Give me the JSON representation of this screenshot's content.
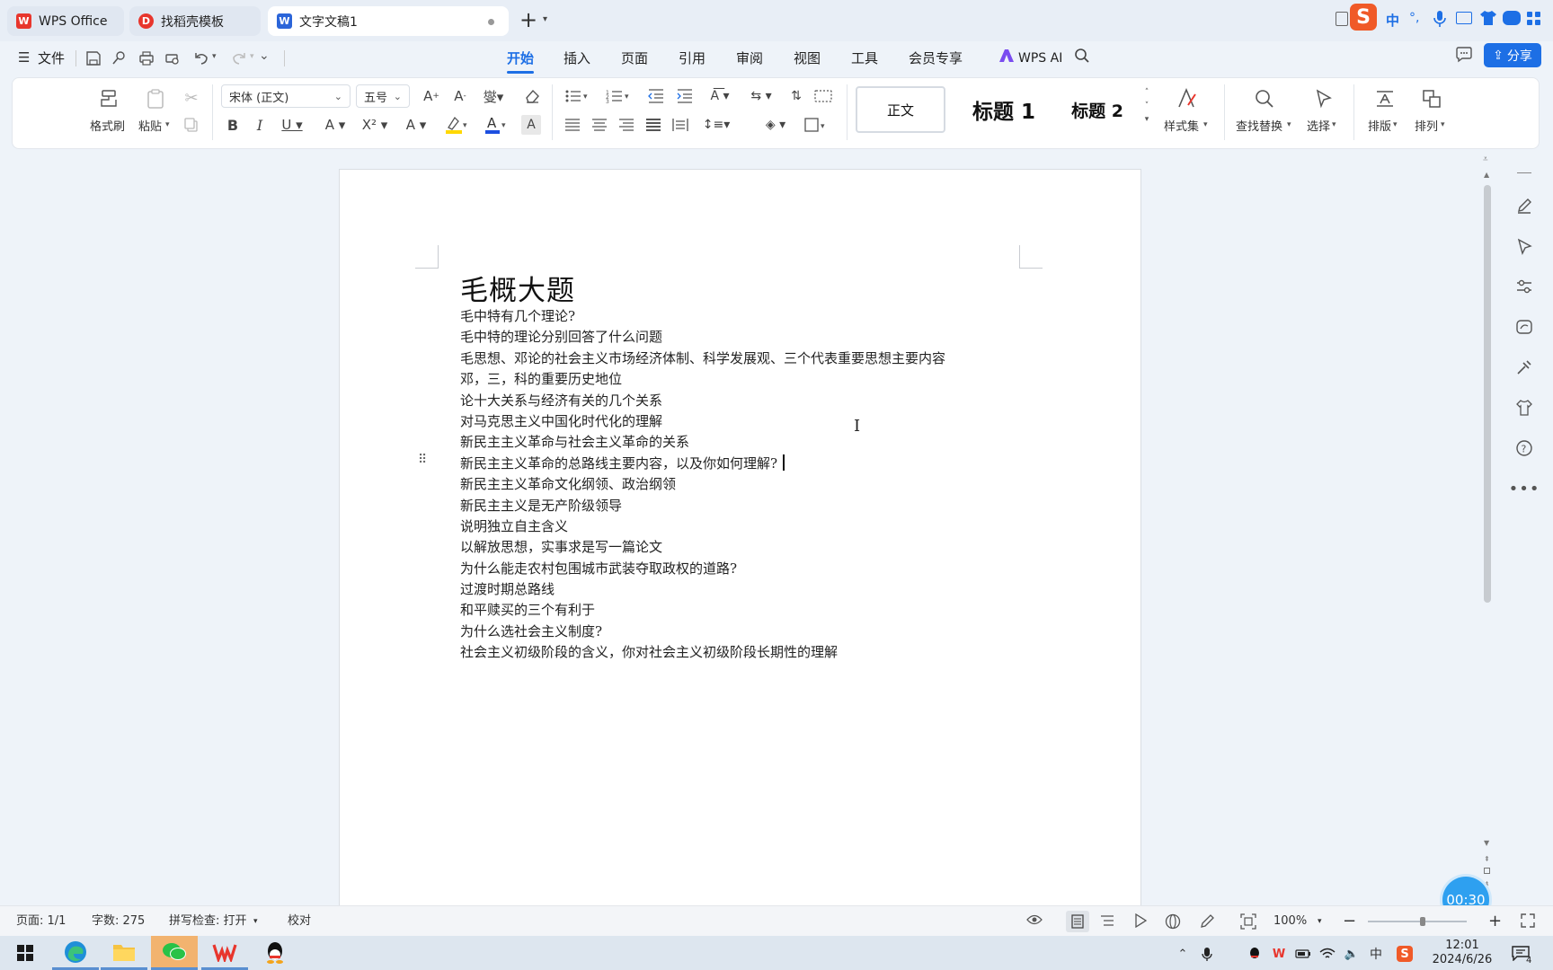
{
  "tabs": [
    {
      "label": "WPS Office",
      "icon": "wps-logo-icon"
    },
    {
      "label": "找稻壳模板",
      "icon": "docer-icon"
    },
    {
      "label": "文字文稿1",
      "icon": "writer-doc-icon"
    }
  ],
  "menu": {
    "file": "文件",
    "items": [
      "开始",
      "插入",
      "页面",
      "引用",
      "审阅",
      "视图",
      "工具",
      "会员专享"
    ],
    "wps_ai": "WPS AI",
    "share": "分享"
  },
  "ribbon": {
    "format_painter": "格式刷",
    "paste": "粘贴",
    "font_name": "宋体 (正文)",
    "font_size": "五号",
    "styles": [
      "正文",
      "标题 1",
      "标题 2"
    ],
    "style_set": "样式集",
    "find_replace": "查找替换",
    "select": "选择",
    "layout": "排版",
    "arrange": "排列"
  },
  "document": {
    "title": "毛概大题",
    "lines": [
      "毛中特有几个理论?",
      "毛中特的理论分别回答了什么问题",
      "毛思想、邓论的社会主义市场经济体制、科学发展观、三个代表重要思想主要内容",
      "邓，三，科的重要历史地位",
      "论十大关系与经济有关的几个关系",
      "对马克思主义中国化时代化的理解",
      "新民主主义革命与社会主义革命的关系",
      "新民主主义革命的总路线主要内容，以及你如何理解?",
      "新民主主义革命文化纲领、政治纲领",
      "新民主主义是无产阶级领导",
      "说明独立自主含义",
      "以解放思想，实事求是写一篇论文",
      "为什么能走农村包围城市武装夺取政权的道路?",
      "过渡时期总路线",
      "和平赎买的三个有利于",
      "为什么选社会主义制度?",
      "社会主义初级阶段的含义，你对社会主义初级阶段长期性的理解"
    ]
  },
  "status": {
    "page": "页面: 1/1",
    "words": "字数: 275",
    "spell": "拼写检查: 打开",
    "proof": "校对",
    "zoom": "100%"
  },
  "timer": "00:30",
  "clock": {
    "time": "12:01",
    "date": "2024/6/26"
  },
  "ime": "中",
  "notification_count": "4",
  "colors": {
    "accent": "#1d6fe5",
    "wps_red": "#e8362d",
    "timer": "#2ea0f0"
  }
}
